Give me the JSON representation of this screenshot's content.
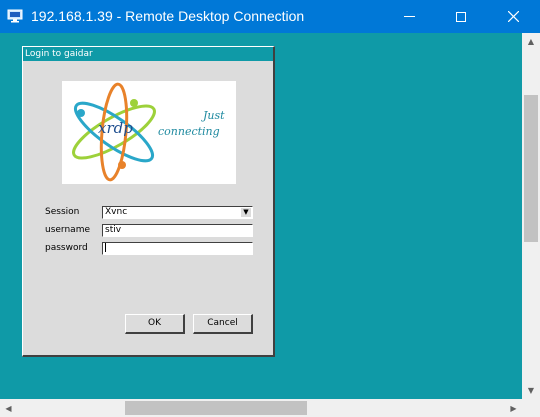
{
  "window": {
    "title": "192.168.1.39 - Remote Desktop Connection",
    "accent": "#0078d7",
    "desktop_color": "#0f9aa7"
  },
  "dialog": {
    "title": "Login to gaidar",
    "logo_text": "xrdp",
    "tagline_line1": "Just",
    "tagline_line2": "connecting",
    "session_label": "Session",
    "session_value": "Xvnc",
    "username_label": "username",
    "username_value": "stiv",
    "password_label": "password",
    "password_value": "",
    "ok_label": "OK",
    "cancel_label": "Cancel"
  },
  "icons": {
    "app": "remote-desktop-icon",
    "minimize": "minimize-icon",
    "maximize": "maximize-icon",
    "close": "close-icon",
    "dropdown": "chevron-down-icon"
  }
}
